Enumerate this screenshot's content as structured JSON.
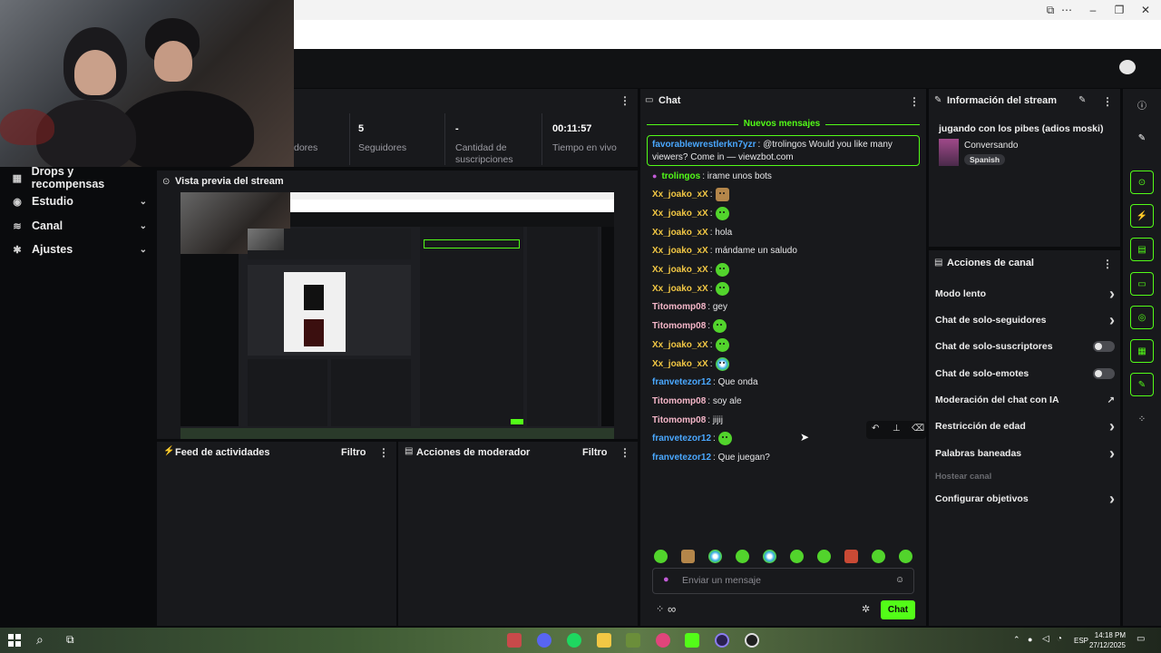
{
  "stream_stats": {
    "followers_partial_label": "dores",
    "followers_value": "5",
    "followers_label": "Seguidores",
    "subs_value": "-",
    "subs_label_1": "Cantidad de",
    "subs_label_2": "suscripciones",
    "time_value": "00:11:57",
    "time_label": "Tiempo en vivo"
  },
  "sidebar": {
    "items": [
      {
        "label": "Drops y recompensas",
        "icon": "gift-icon"
      },
      {
        "label": "Estudio",
        "icon": "studio-icon"
      },
      {
        "label": "Canal",
        "icon": "channel-icon"
      },
      {
        "label": "Ajustes",
        "icon": "gear-icon"
      }
    ]
  },
  "preview": {
    "title": "Vista previa del stream"
  },
  "activity_feed": {
    "title": "Feed de actividades",
    "filter": "Filtro"
  },
  "mod_actions": {
    "title": "Acciones de moderador",
    "filter": "Filtro"
  },
  "chat": {
    "title": "Chat",
    "new_messages": "Nuevos mensajes",
    "highlight": {
      "user": "favorablewrestlerkn7yzr",
      "text": ": @trolingos Would you like many viewers? Come in — viewzbot.com"
    },
    "messages": [
      {
        "user": "trolingos",
        "text": ": irame unos bots",
        "color": "#53fc18"
      },
      {
        "user": "Xx_joako_xX",
        "text": ":",
        "color": "#f2c744",
        "emote": "brown"
      },
      {
        "user": "Xx_joako_xX",
        "text": ":",
        "color": "#f2c744",
        "emote": "green"
      },
      {
        "user": "Xx_joako_xX",
        "text": ": hola",
        "color": "#f2c744"
      },
      {
        "user": "Xx_joako_xX",
        "text": ": mándame un saludo",
        "color": "#f2c744"
      },
      {
        "user": "Xx_joako_xX",
        "text": ":",
        "color": "#f2c744",
        "emote": "green"
      },
      {
        "user": "Xx_joako_xX",
        "text": ":",
        "color": "#f2c744",
        "emote": "green"
      },
      {
        "user": "Titomomp08",
        "text": ": gey",
        "color": "#f4b6c8"
      },
      {
        "user": "Titomomp08",
        "text": ":",
        "color": "#f4b6c8",
        "emote": "green"
      },
      {
        "user": "Xx_joako_xX",
        "text": ":",
        "color": "#f2c744",
        "emote": "green"
      },
      {
        "user": "Xx_joako_xX",
        "text": ":",
        "color": "#f2c744",
        "emote": "multi"
      },
      {
        "user": "franvetezor12",
        "text": ": Que onda",
        "color": "#4aa8ff"
      },
      {
        "user": "Titomomp08",
        "text": ": soy ale",
        "color": "#f4b6c8"
      },
      {
        "user": "Titomomp08",
        "text": ": jijij",
        "color": "#f4b6c8"
      },
      {
        "user": "franvetezor12",
        "text": ":",
        "color": "#4aa8ff",
        "emote": "green"
      },
      {
        "user": "franvetezor12",
        "text": ": Que juegan?",
        "color": "#4aa8ff"
      }
    ],
    "input_placeholder": "Enviar un mensaje",
    "send_label": "Chat",
    "infinity": "∞"
  },
  "stream_info": {
    "title": "Información del stream",
    "stream_title": "jugando con los pibes (adios moski)",
    "category": "Conversando",
    "language": "Spanish"
  },
  "channel_actions": {
    "title": "Acciones de canal",
    "items": [
      {
        "label": "Modo lento",
        "kind": "chevron"
      },
      {
        "label": "Chat de solo-seguidores",
        "kind": "chevron"
      },
      {
        "label": "Chat de solo-suscriptores",
        "kind": "toggle"
      },
      {
        "label": "Chat de solo-emotes",
        "kind": "toggle"
      },
      {
        "label": "Moderación del chat con IA",
        "kind": "external"
      },
      {
        "label": "Restricción de edad",
        "kind": "chevron"
      },
      {
        "label": "Palabras baneadas",
        "kind": "chevron"
      },
      {
        "label": "Hostear canal",
        "kind": "disabled"
      },
      {
        "label": "Configurar objetivos",
        "kind": "chevron"
      }
    ]
  },
  "taskbar": {
    "time": "14:18 PM",
    "date": "27/12/2025",
    "lang": "ESP"
  },
  "colors": {
    "accent": "#53fc18",
    "panel": "#18191c",
    "background": "#0a0b0d"
  }
}
